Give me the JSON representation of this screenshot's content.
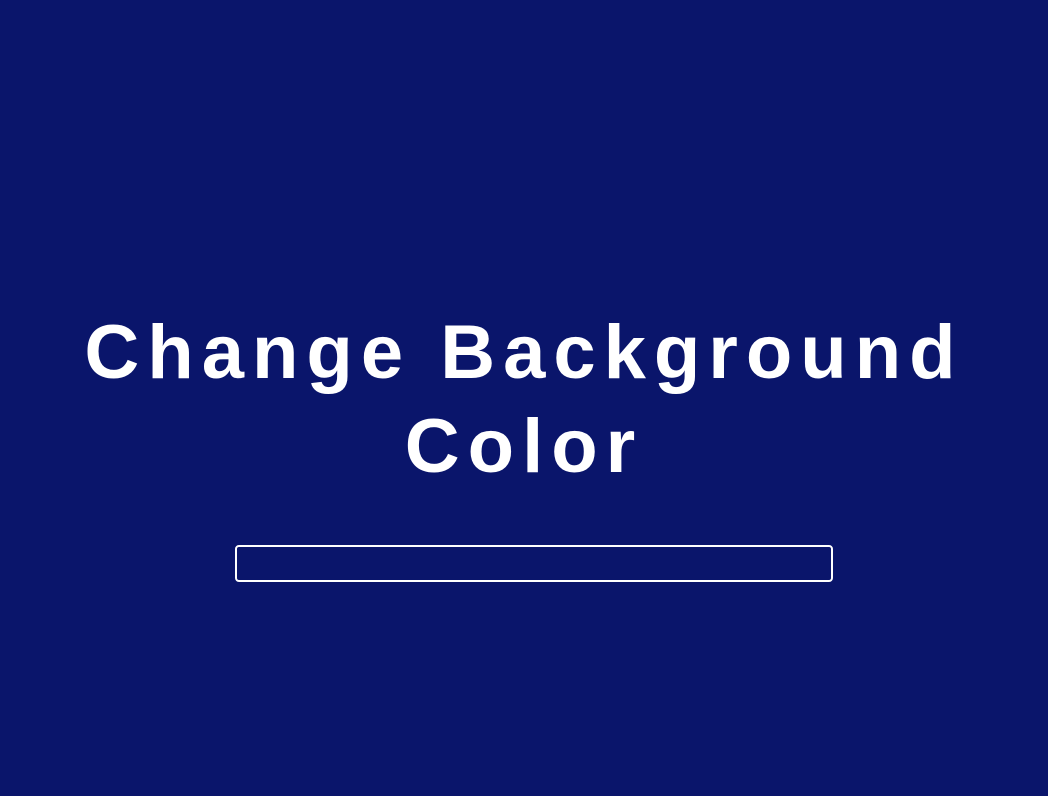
{
  "page": {
    "background_color": "#0a156b",
    "text_color": "#ffffff"
  },
  "heading": {
    "text": "Change Background Color"
  },
  "color_input": {
    "value": "",
    "placeholder": "",
    "border_color": "#ffffff"
  }
}
